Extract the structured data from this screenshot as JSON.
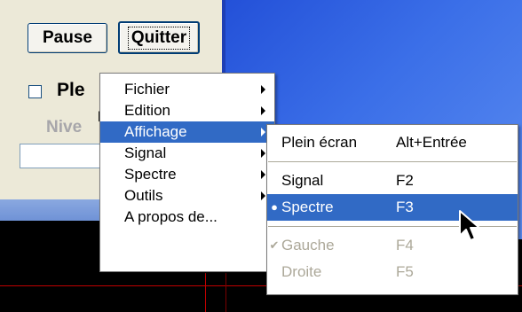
{
  "controls": {
    "pause_label": "Pause",
    "quit_label": "Quitter",
    "checkbox_label": "Ple",
    "checkbox_checked": false,
    "niveau_label": "Nive",
    "niveau_value": "",
    "stray_char": "k"
  },
  "main_menu": {
    "items": [
      {
        "label": "Fichier",
        "has_submenu": true,
        "selected": false
      },
      {
        "label": "Edition",
        "has_submenu": true,
        "selected": false
      },
      {
        "label": "Affichage",
        "has_submenu": true,
        "selected": true
      },
      {
        "label": "Signal",
        "has_submenu": true,
        "selected": false
      },
      {
        "label": "Spectre",
        "has_submenu": true,
        "selected": false
      },
      {
        "label": "Outils",
        "has_submenu": true,
        "selected": false
      },
      {
        "label": "A propos de...",
        "has_submenu": false,
        "selected": false
      }
    ]
  },
  "submenu_affichage": {
    "items": [
      {
        "label": "Plein écran",
        "shortcut": "Alt+Entrée"
      },
      {
        "label": "Signal",
        "shortcut": "F2"
      },
      {
        "label": "Spectre",
        "shortcut": "F3",
        "radio": true,
        "selected": true
      },
      {
        "label": "Gauche",
        "shortcut": "F4",
        "checked": true,
        "disabled": true
      },
      {
        "label": "Droite",
        "shortcut": "F5",
        "disabled": true
      }
    ]
  },
  "colors": {
    "menu_highlight": "#316ac5",
    "panel_bg": "#ece9d8",
    "display_blue": "#3b6fe8",
    "trace_red": "#c00000"
  }
}
